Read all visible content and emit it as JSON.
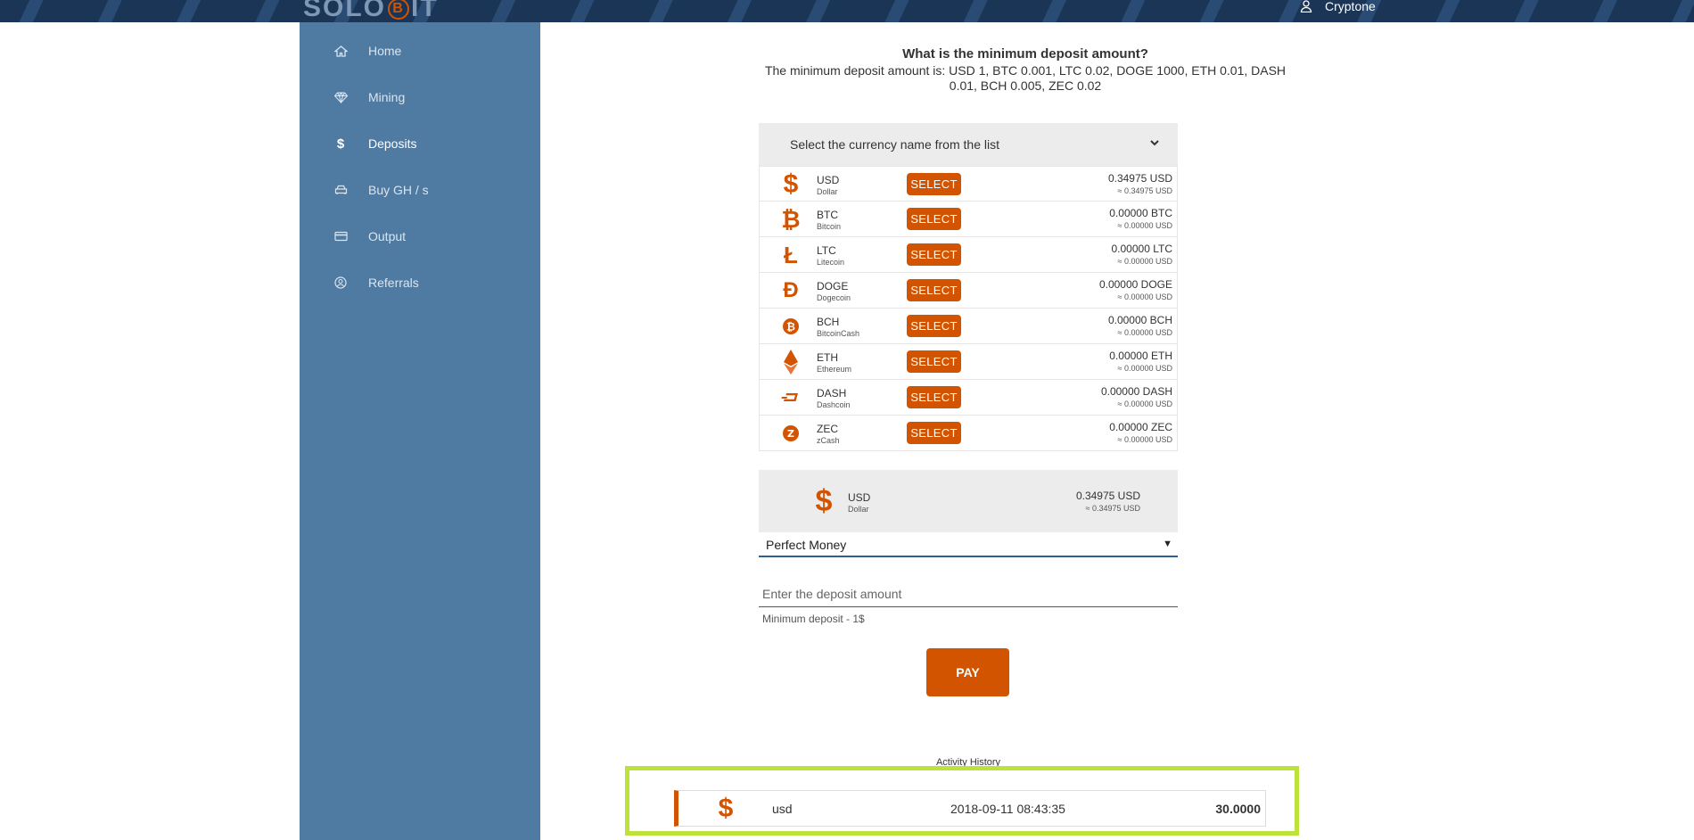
{
  "header": {
    "logo_left": "SOLO",
    "logo_mid": "B",
    "logo_right": "IT",
    "username": "Cryptone"
  },
  "sidebar": {
    "items": [
      {
        "label": "Home",
        "icon": "home-icon"
      },
      {
        "label": "Mining",
        "icon": "diamond-icon"
      },
      {
        "label": "Deposits",
        "icon": "dollar-icon",
        "active": true
      },
      {
        "label": "Buy GH / s",
        "icon": "car-icon"
      },
      {
        "label": "Output",
        "icon": "credit-card-icon"
      },
      {
        "label": "Referrals",
        "icon": "user-circle-icon"
      }
    ]
  },
  "faq": {
    "question": "What is the minimum deposit amount?",
    "answer": "The minimum deposit amount is: USD 1, BTC 0.001, LTC 0.02, DOGE 1000, ETH 0.01, DASH 0.01, BCH 0.005, ZEC 0.02"
  },
  "currency_select": {
    "placeholder": "Select the currency name from the list",
    "select_label": "SELECT",
    "items": [
      {
        "code": "USD",
        "name": "Dollar",
        "balance": "0.34975 USD",
        "usd": "≈ 0.34975 USD",
        "icon": "dollar-icon"
      },
      {
        "code": "BTC",
        "name": "Bitcoin",
        "balance": "0.00000 BTC",
        "usd": "≈ 0.00000 USD",
        "icon": "bitcoin-icon"
      },
      {
        "code": "LTC",
        "name": "Litecoin",
        "balance": "0.00000 LTC",
        "usd": "≈ 0.00000 USD",
        "icon": "litecoin-icon"
      },
      {
        "code": "DOGE",
        "name": "Dogecoin",
        "balance": "0.00000 DOGE",
        "usd": "≈ 0.00000 USD",
        "icon": "dogecoin-icon"
      },
      {
        "code": "BCH",
        "name": "BitcoinCash",
        "balance": "0.00000 BCH",
        "usd": "≈ 0.00000 USD",
        "icon": "bitcoin-cash-icon"
      },
      {
        "code": "ETH",
        "name": "Ethereum",
        "balance": "0.00000 ETH",
        "usd": "≈ 0.00000 USD",
        "icon": "ethereum-icon"
      },
      {
        "code": "DASH",
        "name": "Dashcoin",
        "balance": "0.00000 DASH",
        "usd": "≈ 0.00000 USD",
        "icon": "dash-icon"
      },
      {
        "code": "ZEC",
        "name": "zCash",
        "balance": "0.00000 ZEC",
        "usd": "≈ 0.00000 USD",
        "icon": "zcash-icon"
      }
    ]
  },
  "selected_currency": {
    "code": "USD",
    "name": "Dollar",
    "balance": "0.34975 USD",
    "usd": "≈ 0.34975 USD"
  },
  "payment_method": {
    "value": "Perfect Money",
    "arrow": "▼"
  },
  "deposit": {
    "placeholder": "Enter the deposit amount",
    "minimum_note": "Minimum deposit - 1$",
    "pay_label": "PAY"
  },
  "history": {
    "title": "Activity History",
    "rows": [
      {
        "currency": "usd",
        "date": "2018-09-11 08:43:35",
        "amount": "30.0000"
      }
    ]
  },
  "colors": {
    "accent": "#d35400",
    "sidebar": "#4f7aa1",
    "header": "#1d3a5c",
    "highlight": "#bde23a"
  }
}
